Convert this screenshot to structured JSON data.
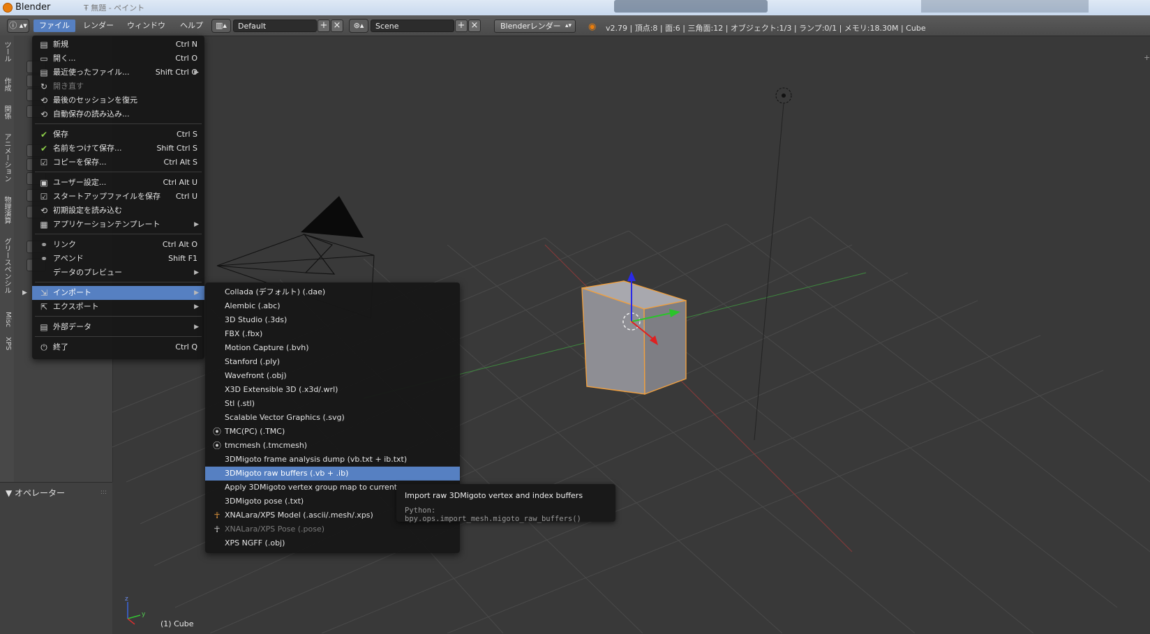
{
  "window": {
    "title": "Blender",
    "blurred_title": "Ŧ 無題 - ペイント"
  },
  "header": {
    "menus": [
      "ファイル",
      "レンダー",
      "ウィンドウ",
      "ヘルプ"
    ],
    "layout": "Default",
    "scene": "Scene",
    "engine": "Blenderレンダー",
    "stats": "v2.79 | 頂点:8 | 面:6 | 三角面:12 | オブジェクト:1/3 | ランプ:0/1 | メモリ:18.30M | Cube"
  },
  "tool_tabs": [
    "ツール",
    "作成",
    "関係",
    "アニメーション",
    "物理演算",
    "グリースペンシル",
    "Misc",
    "XPS"
  ],
  "operator_panel": {
    "title": "オペレーター"
  },
  "file_menu": {
    "items": [
      {
        "label": "新規",
        "shortcut": "Ctrl N",
        "icon": "new-file-icon"
      },
      {
        "label": "開く...",
        "shortcut": "Ctrl O",
        "icon": "folder-open-icon"
      },
      {
        "label": "最近使ったファイル...",
        "shortcut": "Shift Ctrl O",
        "icon": "recent-files-icon",
        "submenu": true
      },
      {
        "label": "開き直す",
        "shortcut": "",
        "icon": "reload-icon",
        "disabled": true
      },
      {
        "label": "最後のセッションを復元",
        "shortcut": "",
        "icon": "recover-icon"
      },
      {
        "label": "自動保存の読み込み...",
        "shortcut": "",
        "icon": "recover-auto-icon"
      },
      {
        "sep": true
      },
      {
        "label": "保存",
        "shortcut": "Ctrl S",
        "icon": "checkmark-icon"
      },
      {
        "label": "名前をつけて保存...",
        "shortcut": "Shift Ctrl S",
        "icon": "save-as-icon"
      },
      {
        "label": "コピーを保存...",
        "shortcut": "Ctrl Alt S",
        "icon": "save-copy-icon"
      },
      {
        "sep": true
      },
      {
        "label": "ユーザー設定...",
        "shortcut": "Ctrl Alt U",
        "icon": "preferences-icon"
      },
      {
        "label": "スタートアップファイルを保存",
        "shortcut": "Ctrl U",
        "icon": "save-prefs-icon"
      },
      {
        "label": "初期設定を読み込む",
        "shortcut": "",
        "icon": "load-factory-icon"
      },
      {
        "label": "アプリケーションテンプレート",
        "shortcut": "",
        "icon": "template-icon",
        "submenu": true
      },
      {
        "sep": true
      },
      {
        "label": "リンク",
        "shortcut": "Ctrl Alt O",
        "icon": "link-icon"
      },
      {
        "label": "アペンド",
        "shortcut": "Shift F1",
        "icon": "append-icon"
      },
      {
        "label": "データのプレビュー",
        "shortcut": "",
        "icon": "",
        "submenu": true
      },
      {
        "sep": true
      },
      {
        "label": "インポート",
        "shortcut": "",
        "icon": "import-icon",
        "submenu": true,
        "highlighted": true
      },
      {
        "label": "エクスポート",
        "shortcut": "",
        "icon": "export-icon",
        "submenu": true
      },
      {
        "sep": true
      },
      {
        "label": "外部データ",
        "shortcut": "",
        "icon": "external-data-icon",
        "submenu": true
      },
      {
        "sep": true
      },
      {
        "label": "終了",
        "shortcut": "Ctrl Q",
        "icon": "power-icon"
      }
    ]
  },
  "import_menu": {
    "items": [
      {
        "label": "Collada (デフォルト) (.dae)",
        "icon": ""
      },
      {
        "label": "Alembic (.abc)",
        "icon": ""
      },
      {
        "label": "3D Studio (.3ds)",
        "icon": ""
      },
      {
        "label": "FBX (.fbx)",
        "icon": ""
      },
      {
        "label": "Motion Capture (.bvh)",
        "icon": ""
      },
      {
        "label": "Stanford (.ply)",
        "icon": ""
      },
      {
        "label": "Wavefront (.obj)",
        "icon": ""
      },
      {
        "label": "X3D Extensible 3D (.x3d/.wrl)",
        "icon": ""
      },
      {
        "label": "Stl (.stl)",
        "icon": ""
      },
      {
        "label": "Scalable Vector Graphics (.svg)",
        "icon": ""
      },
      {
        "label": "TMC(PC) (.TMC)",
        "icon": "tmc-icon"
      },
      {
        "label": "tmcmesh (.tmcmesh)",
        "icon": "tmc-icon"
      },
      {
        "label": "3DMigoto frame analysis dump (vb.txt + ib.txt)",
        "icon": ""
      },
      {
        "label": "3DMigoto raw buffers (.vb + .ib)",
        "icon": "",
        "highlighted": true
      },
      {
        "label": "Apply 3DMigoto vertex group map to current object (.vgmap)",
        "icon": ""
      },
      {
        "label": "3DMigoto pose (.txt)",
        "icon": ""
      },
      {
        "label": "XNALara/XPS Model (.ascii/.mesh/.xps)",
        "icon": "xps-figure-icon"
      },
      {
        "label": "XNALara/XPS Pose (.pose)",
        "icon": "xps-pose-icon",
        "disabled": true
      },
      {
        "label": "XPS NGFF (.obj)",
        "icon": ""
      }
    ]
  },
  "tooltip": {
    "title": "Import raw 3DMigoto vertex and index buffers",
    "python": "Python: bpy.ops.import_mesh.migoto_raw_buffers()"
  },
  "viewport": {
    "info": "(1) Cube",
    "axis_x": "x",
    "axis_y": "y",
    "axis_z": "z"
  },
  "colors": {
    "accent": "#5680c2",
    "background": "#393939",
    "menu_bg": "#161616",
    "selection": "#f0a040"
  }
}
